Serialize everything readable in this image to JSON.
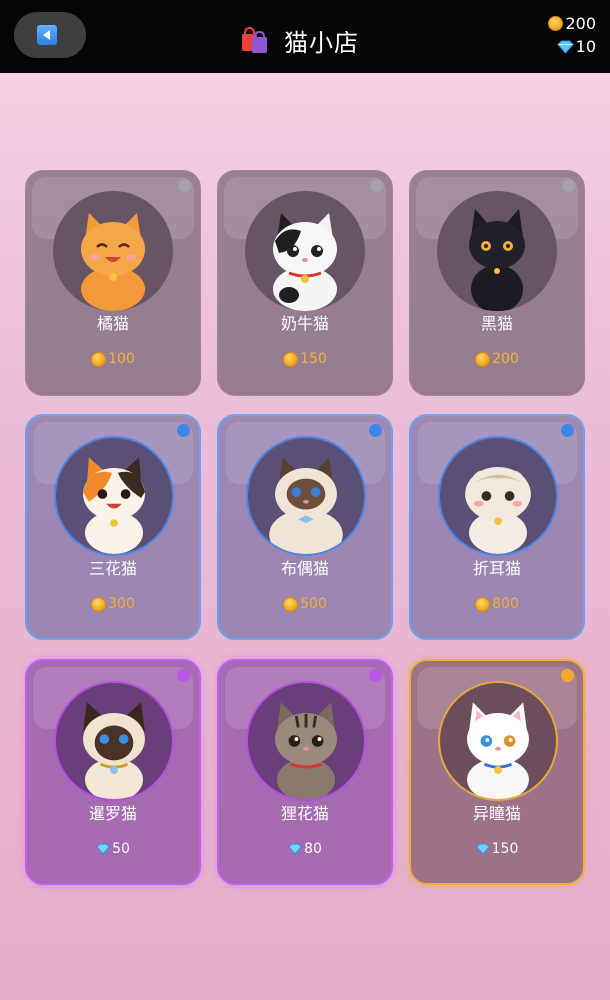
{
  "header": {
    "title": "猫小店",
    "coins": "200",
    "gems": "10"
  },
  "cats": [
    {
      "name": "橘猫",
      "price": "100",
      "currency": "coin",
      "rarity": "common"
    },
    {
      "name": "奶牛猫",
      "price": "150",
      "currency": "coin",
      "rarity": "common"
    },
    {
      "name": "黑猫",
      "price": "200",
      "currency": "coin",
      "rarity": "common"
    },
    {
      "name": "三花猫",
      "price": "300",
      "currency": "coin",
      "rarity": "rare"
    },
    {
      "name": "布偶猫",
      "price": "500",
      "currency": "coin",
      "rarity": "rare"
    },
    {
      "name": "折耳猫",
      "price": "800",
      "currency": "coin",
      "rarity": "rare"
    },
    {
      "name": "暹罗猫",
      "price": "50",
      "currency": "gem",
      "rarity": "epic"
    },
    {
      "name": "狸花猫",
      "price": "80",
      "currency": "gem",
      "rarity": "epic"
    },
    {
      "name": "异瞳猫",
      "price": "150",
      "currency": "gem",
      "rarity": "legendary"
    }
  ],
  "icons": {
    "back": "back-arrow-icon",
    "shop": "shopping-bag-icon",
    "coin": "gold-coin-icon",
    "gem": "diamond-icon"
  },
  "colors": {
    "common": "#a9a0a8",
    "rare": "#3d86ea",
    "epic": "#b857e6",
    "legendary": "#f3a92f",
    "coin_text": "#f2b233"
  }
}
